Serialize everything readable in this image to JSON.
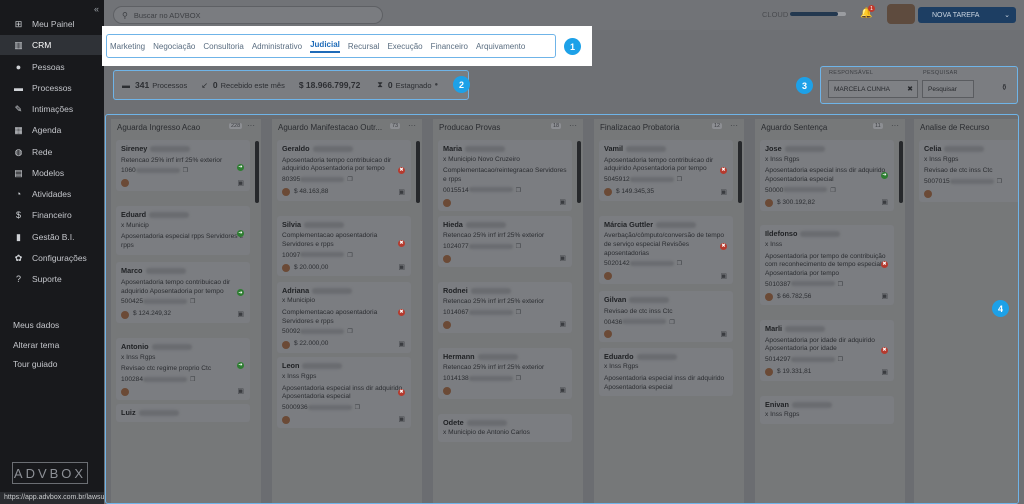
{
  "sidebar": {
    "items": [
      {
        "label": "Meu Painel",
        "icon": "grid-icon"
      },
      {
        "label": "CRM",
        "icon": "columns-icon"
      },
      {
        "label": "Pessoas",
        "icon": "person-icon"
      },
      {
        "label": "Processos",
        "icon": "folder-icon"
      },
      {
        "label": "Intimações",
        "icon": "megaphone-icon"
      },
      {
        "label": "Agenda",
        "icon": "calendar-icon"
      },
      {
        "label": "Rede",
        "icon": "globe-icon"
      },
      {
        "label": "Modelos",
        "icon": "document-icon"
      },
      {
        "label": "Atividades",
        "icon": "chart-icon"
      },
      {
        "label": "Financeiro",
        "icon": "dollar-icon"
      },
      {
        "label": "Gestão B.I.",
        "icon": "bar-chart-icon"
      },
      {
        "label": "Configurações",
        "icon": "gear-icon"
      },
      {
        "label": "Suporte",
        "icon": "question-icon"
      }
    ],
    "links": [
      "Meus dados",
      "Alterar tema",
      "Tour guiado"
    ],
    "logo": "ADVBOX",
    "status_url": "https://app.advbox.com.br/lawsuits/12583/edit"
  },
  "topbar": {
    "search_placeholder": "Buscar no ADVBOX",
    "cloud_label": "CLOUD",
    "cloud_usage": 0.85,
    "notifications": "1",
    "new_task": "NOVA TAREFA"
  },
  "tabs": [
    "Marketing",
    "Negociação",
    "Consultoria",
    "Administrativo",
    "Judicial",
    "Recursal",
    "Execução",
    "Financeiro",
    "Arquivamento"
  ],
  "active_tab": "Judicial",
  "stats": {
    "processes": "341",
    "processes_label": "Processos",
    "received": "0",
    "received_label": "Recebido este mês",
    "value": "$  18.966.799,72",
    "stagnant": "0",
    "stagnant_label": "Estagnado"
  },
  "filters": {
    "responsavel_label": "RESPONSÁVEL",
    "responsavel_value": "MARCELA CUNHA",
    "pesquisar_label": "PESQUISAR",
    "pesquisar_placeholder": "Pesquisar"
  },
  "annotations": [
    "1",
    "2",
    "3",
    "4"
  ],
  "columns": [
    {
      "title": "Aguarda Ingresso Acao",
      "count": "228",
      "cards": [
        {
          "name": "Sireney",
          "sub": "",
          "desc": "Retencao 25% irrf irrf 25% exterior",
          "num": "1060",
          "value": "",
          "status": "g"
        },
        {
          "name": "Eduard",
          "sub": "x Municip",
          "desc": "Aposentadoria especial rpps Servidores e rpps",
          "num": "",
          "value": "",
          "status": "g"
        },
        {
          "name": "Marco",
          "sub": "",
          "desc": "Aposentadoria tempo contribuicao dir adquirido Aposentadoria por tempo",
          "num": "500425",
          "value": "$ 124.249,32",
          "status": "g"
        },
        {
          "name": "Antonio",
          "sub": "x Inss Rgps",
          "desc": "Revisao ctc regime proprio Ctc",
          "num": "100284",
          "value": "",
          "status": "g"
        },
        {
          "name": "Luiz",
          "sub": "",
          "desc": "",
          "num": "",
          "value": "",
          "status": ""
        }
      ]
    },
    {
      "title": "Aguardo Manifestacao Outr...",
      "count": "73",
      "cards": [
        {
          "name": "Geraldo",
          "sub": "",
          "desc": "Aposentadoria tempo contribuicao dir adquirido Aposentadoria por tempo",
          "num": "80395",
          "value": "$ 48.163,88",
          "status": "r"
        },
        {
          "name": "Silvia",
          "sub": "",
          "desc": "Complementacao aposentadoria Servidores e rpps",
          "num": "10097",
          "value": "$ 20.000,00",
          "status": "r"
        },
        {
          "name": "Adriana",
          "sub": "x Municipio",
          "desc": "Complementacao aposentadoria Servidores e rpps",
          "num": "50092",
          "value": "$ 22.000,00",
          "status": "r"
        },
        {
          "name": "Leon",
          "sub": "x Inss Rgps",
          "desc": "Aposentadoria especial inss dir adquirido Aposentadoria especial",
          "num": "5000936",
          "value": "",
          "status": "r"
        }
      ]
    },
    {
      "title": "Producao Provas",
      "count": "18",
      "cards": [
        {
          "name": "Maria",
          "sub": "x Municipio Novo Cruzeiro",
          "desc": "Complementacao/reintegracao Servidores e rpps",
          "num": "0015514",
          "value": "",
          "status": ""
        },
        {
          "name": "Hieda",
          "sub": "",
          "desc": "Retencao 25% irrf irrf 25% exterior",
          "num": "1024077",
          "value": "",
          "status": ""
        },
        {
          "name": "Rodnei",
          "sub": "",
          "desc": "Retencao 25% irrf irrf 25% exterior",
          "num": "1014067",
          "value": "",
          "status": ""
        },
        {
          "name": "Hermann",
          "sub": "",
          "desc": "Retencao 25% irrf irrf 25% exterior",
          "num": "1014138",
          "value": "",
          "status": ""
        },
        {
          "name": "Odete",
          "sub": "x Municipio de Antonio Carlos",
          "desc": "",
          "num": "",
          "value": "",
          "status": ""
        }
      ]
    },
    {
      "title": "Finalizacao Probatoria",
      "count": "12",
      "cards": [
        {
          "name": "Vamil",
          "sub": "",
          "desc": "Aposentadoria tempo contribuicao dir adquirido Aposentadoria por tempo",
          "num": "5045912",
          "value": "$ 149.345,35",
          "status": "r"
        },
        {
          "name": "Márcia Guttler",
          "sub": "",
          "desc": "Averbação/cômputo/conversão de tempo de serviço especial Revisões aposentadorias",
          "num": "5020142",
          "value": "",
          "status": "r"
        },
        {
          "name": "Gilvan",
          "sub": "",
          "desc": "Revisao de ctc inss Ctc",
          "num": "00436",
          "value": "",
          "status": ""
        },
        {
          "name": "Eduardo",
          "sub": "x Inss Rgps",
          "desc": "Aposentadoria especial inss dir adquirido Aposentadoria especial",
          "num": "",
          "value": "",
          "status": ""
        }
      ]
    },
    {
      "title": "Aguardo Sentença",
      "count": "11",
      "cards": [
        {
          "name": "Jose",
          "sub": "x Inss Rgps",
          "desc": "Aposentadoria especial inss dir adquirido Aposentadoria especial",
          "num": "50000",
          "value": "$ 300.192,82",
          "status": "g"
        },
        {
          "name": "Ildefonso",
          "sub": "x Inss",
          "desc": "Aposentadoria por tempo de contribuição com reconhecimento de tempo especial Aposentadoria por tempo",
          "num": "5010387",
          "value": "$ 66.782,56",
          "status": "r"
        },
        {
          "name": "Marli",
          "sub": "",
          "desc": "Aposentadoria por idade dir adquirido Aposentadoria por idade",
          "num": "5014297",
          "value": "$ 19.331,81",
          "status": "r"
        },
        {
          "name": "Enivan",
          "sub": "x Inss Rgps",
          "desc": "",
          "num": "",
          "value": "",
          "status": ""
        }
      ]
    },
    {
      "title": "Analise de Recurso",
      "count": "",
      "cards": [
        {
          "name": "Celia",
          "sub": "x Inss Rgps",
          "desc": "Revisao de ctc inss Ctc",
          "num": "5007015",
          "value": "",
          "status": ""
        }
      ]
    }
  ]
}
